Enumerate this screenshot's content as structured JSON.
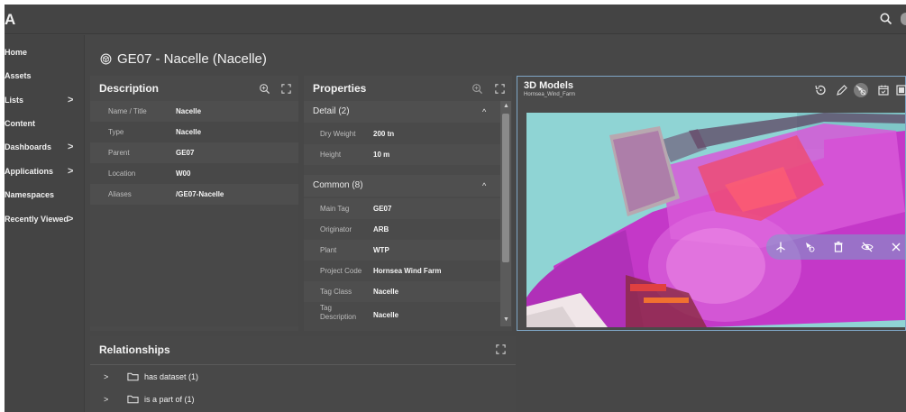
{
  "app": {
    "logo": "A"
  },
  "sidebar": {
    "items": [
      {
        "label": "Home",
        "chevron": ""
      },
      {
        "label": "Assets",
        "chevron": ""
      },
      {
        "label": "Lists",
        "chevron": ">"
      },
      {
        "label": "Content",
        "chevron": ""
      },
      {
        "label": "Dashboards",
        "chevron": ">"
      },
      {
        "label": "Applications",
        "chevron": ">"
      },
      {
        "label": "Namespaces",
        "chevron": ""
      },
      {
        "label": "Recently Viewed",
        "chevron": ">"
      }
    ]
  },
  "page": {
    "title": "GE07 - Nacelle (Nacelle)",
    "title_icon": "cube-icon"
  },
  "description": {
    "title": "Description",
    "rows": [
      {
        "key": "Name / Title",
        "value": "Nacelle"
      },
      {
        "key": "Type",
        "value": "Nacelle"
      },
      {
        "key": "Parent",
        "value": "GE07"
      },
      {
        "key": "Location",
        "value": "W00"
      },
      {
        "key": "Aliases",
        "value": "/GE07-Nacelle"
      }
    ]
  },
  "properties": {
    "title": "Properties",
    "sections": [
      {
        "title": "Detail (2)",
        "caret": "^",
        "rows": [
          {
            "key": "Dry Weight",
            "value": "200 tn"
          },
          {
            "key": "Height",
            "value": "10 m"
          }
        ]
      },
      {
        "title": "Common (8)",
        "caret": "^",
        "rows": [
          {
            "key": "Main Tag",
            "value": "GE07"
          },
          {
            "key": "Originator",
            "value": "ARB"
          },
          {
            "key": "Plant",
            "value": "WTP"
          },
          {
            "key": "Project Code",
            "value": "Hornsea Wind Farm"
          },
          {
            "key": "Tag Class",
            "value": "Nacelle"
          },
          {
            "key": "Tag Description",
            "value": "Nacelle"
          }
        ]
      }
    ]
  },
  "models": {
    "title": "3D Models",
    "subtitle": "Hornsea_Wind_Farm"
  },
  "relationships": {
    "title": "Relationships",
    "items": [
      {
        "label": "has dataset (1)",
        "chevron": ">"
      },
      {
        "label": "is a part of (1)",
        "chevron": ">"
      }
    ]
  },
  "colors": {
    "background": "#474747",
    "panel": "#4a4a4a",
    "accent_border": "#7ea6c6",
    "model_magenta": "#d23ed6",
    "model_cyan": "#8fd4d4"
  }
}
